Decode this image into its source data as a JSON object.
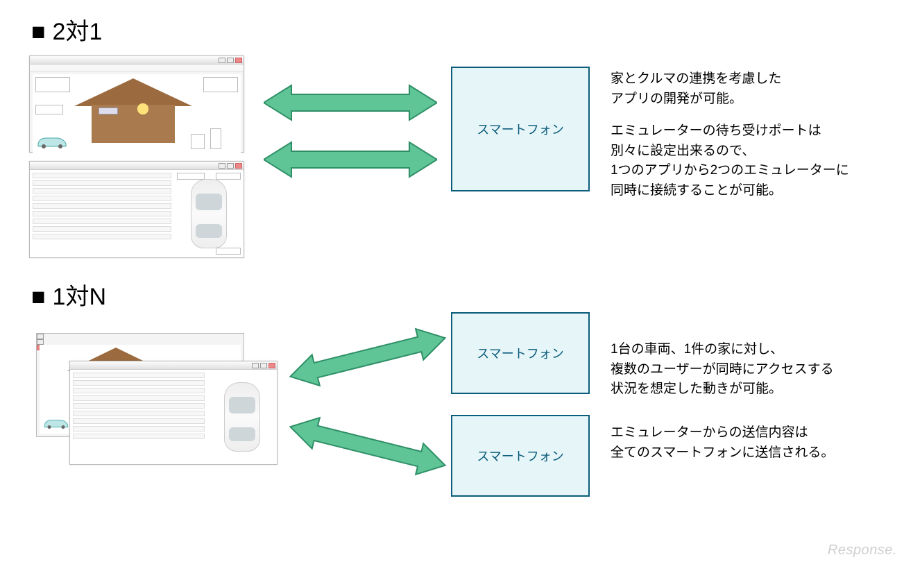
{
  "section1": {
    "title": "2対1",
    "smartphone_label": "スマートフォン",
    "desc1": "家とクルマの連携を考慮した\nアプリの開発が可能。",
    "desc2": "エミュレーターの待ち受けポートは\n別々に設定出来るので、\n1つのアプリから2つのエミュレーターに\n同時に接続することが可能。"
  },
  "section2": {
    "title": "1対N",
    "smartphone_label_1": "スマートフォン",
    "smartphone_label_2": "スマートフォン",
    "desc1": "1台の車両、1件の家に対し、\n複数のユーザーが同時にアクセスする\n状況を想定した動きが可能。",
    "desc2": "エミュレーターからの送信内容は\n全てのスマートフォンに送信される。"
  },
  "watermark": "Response.",
  "colors": {
    "arrow_fill": "#5fc597",
    "arrow_stroke": "#2e8f66",
    "phone_fill": "#e5f5f8",
    "phone_stroke": "#0a5c7a"
  }
}
